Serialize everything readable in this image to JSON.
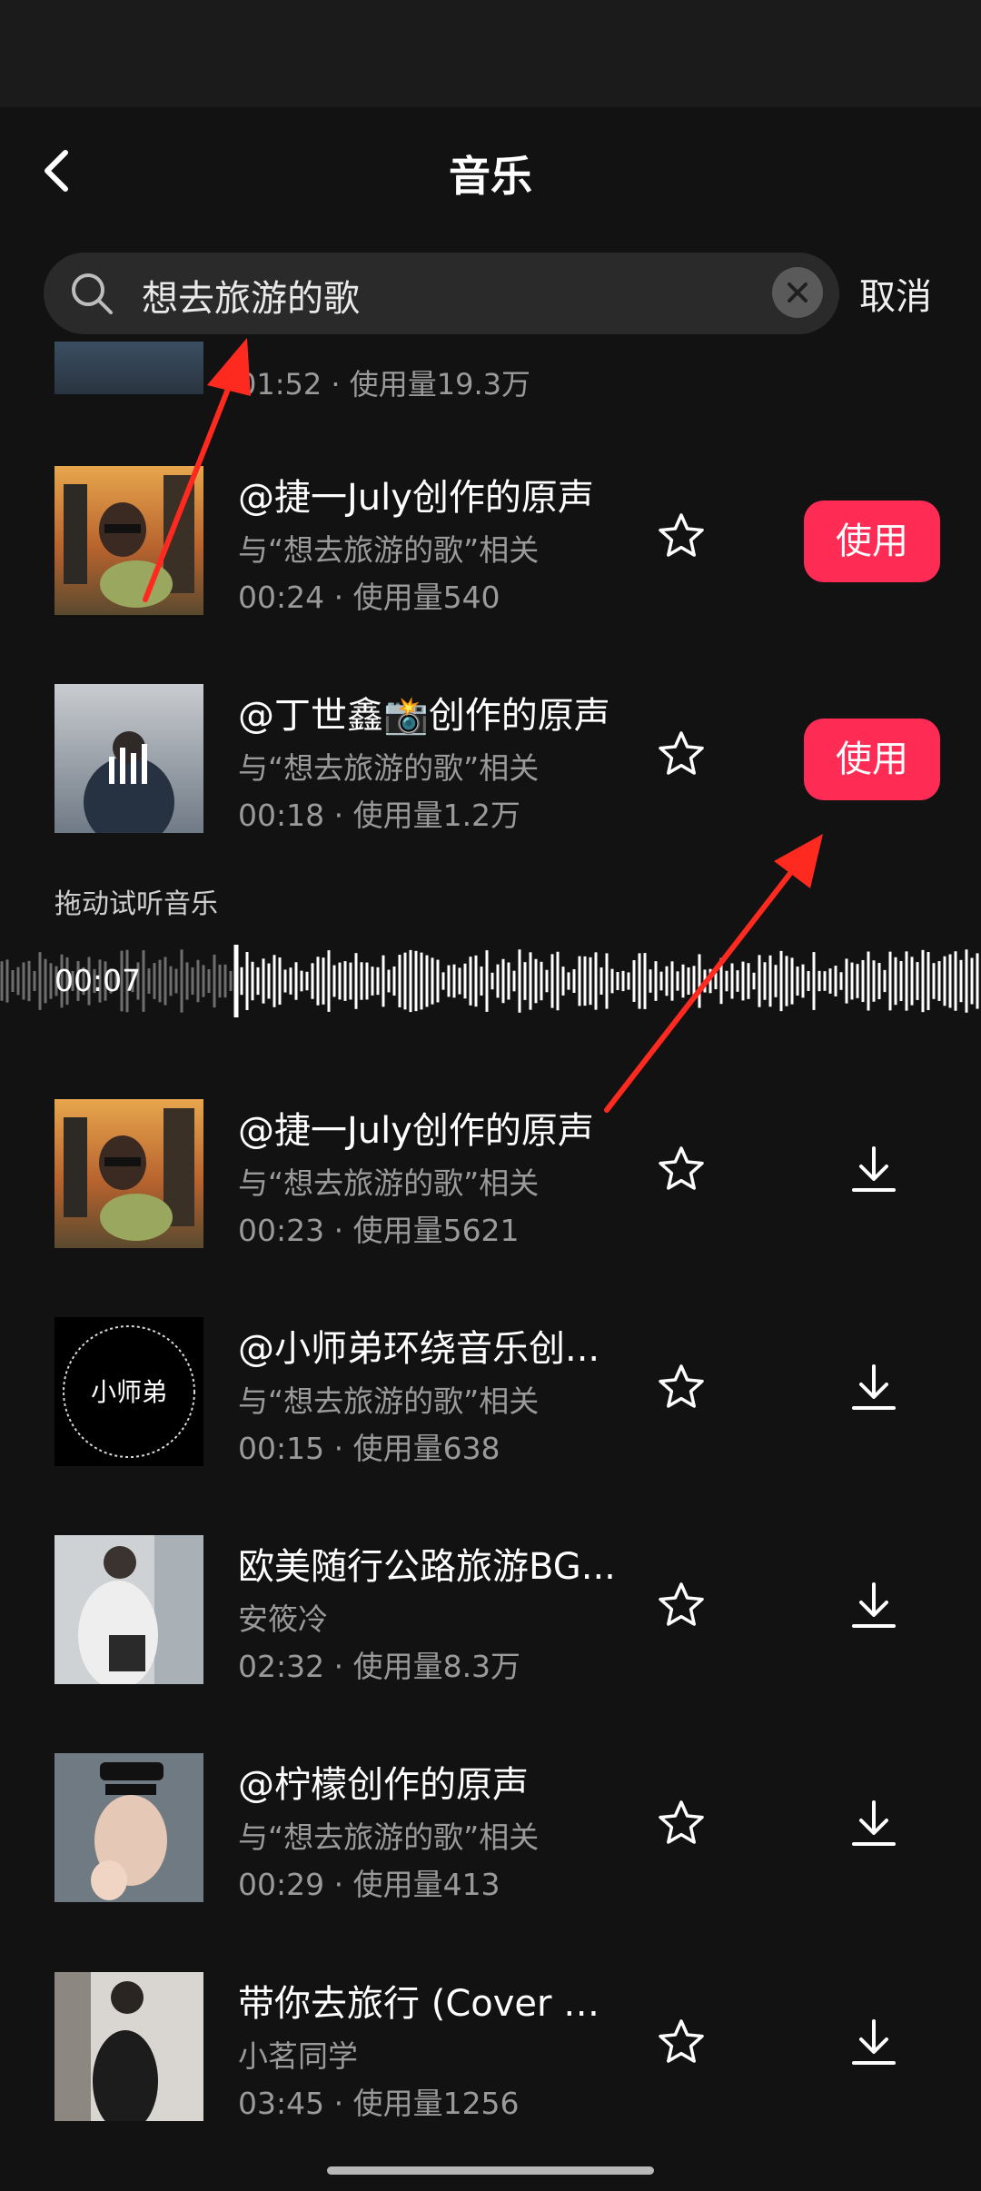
{
  "header": {
    "title": "音乐"
  },
  "search": {
    "query": "想去旅游的歌",
    "cancel_label": "取消"
  },
  "partial_item": {
    "meta": "01:52 · 使用量19.3万"
  },
  "items": [
    {
      "title": "@捷一July创作的原声",
      "sub": "与“想去旅游的歌”相关",
      "meta": "00:24 · 使用量540",
      "action": "使用"
    },
    {
      "title": "@丁世鑫📸创作的原声",
      "sub": "与“想去旅游的歌”相关",
      "meta": "00:18 · 使用量1.2万",
      "action": "使用"
    },
    {
      "title": "@捷一July创作的原声",
      "sub": "与“想去旅游的歌”相关",
      "meta": "00:23 · 使用量5621",
      "action": "download-icon"
    },
    {
      "title": "@小师弟环绕音乐创...",
      "sub": "与“想去旅游的歌”相关",
      "meta": "00:15 · 使用量638",
      "action": "download-icon",
      "thumb_text": "小师弟"
    },
    {
      "title": "欧美随行公路旅游BG...",
      "sub": "安筱冷",
      "meta": "02:32 · 使用量8.3万",
      "action": "download-icon"
    },
    {
      "title": "@柠檬创作的原声",
      "sub": "与“想去旅游的歌”相关",
      "meta": "00:29 · 使用量413",
      "action": "download-icon"
    },
    {
      "title": "带你去旅行 (Cover 校...",
      "sub": "小茗同学",
      "meta": "03:45 · 使用量1256",
      "action": "download-icon"
    }
  ],
  "preview": {
    "label": "拖动试听音乐",
    "time": "00:07"
  },
  "colors": {
    "background": "#121212",
    "accent": "#fe2c55",
    "annotation": "#ff2a1f"
  }
}
